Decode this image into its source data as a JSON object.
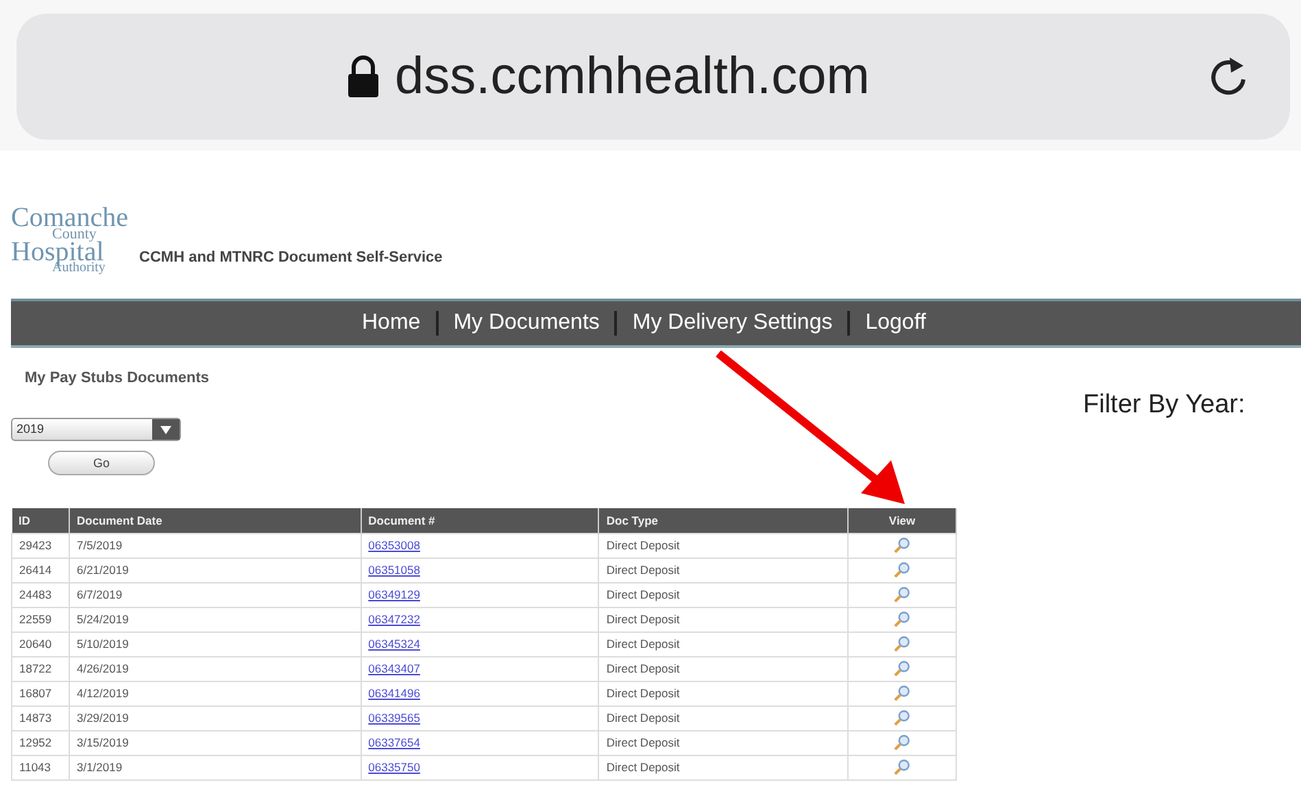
{
  "browser": {
    "url": "dss.ccmhhealth.com"
  },
  "logo": {
    "lines": [
      "Comanche",
      "County",
      "Hospital",
      "Authority"
    ]
  },
  "site_title": "CCMH and MTNRC Document Self-Service",
  "nav": [
    "Home",
    "My Documents",
    "My Delivery Settings",
    "Logoff"
  ],
  "section_title": "My Pay Stubs Documents",
  "filter_label": "Filter By Year:",
  "year_select": {
    "value": "2019"
  },
  "go_button": "Go",
  "table": {
    "columns": [
      "ID",
      "Document Date",
      "Document #",
      "Doc Type",
      "View"
    ],
    "rows": [
      {
        "id": "29423",
        "date": "7/5/2019",
        "doc": "06353008",
        "type": "Direct Deposit"
      },
      {
        "id": "26414",
        "date": "6/21/2019",
        "doc": "06351058",
        "type": "Direct Deposit"
      },
      {
        "id": "24483",
        "date": "6/7/2019",
        "doc": "06349129",
        "type": "Direct Deposit"
      },
      {
        "id": "22559",
        "date": "5/24/2019",
        "doc": "06347232",
        "type": "Direct Deposit"
      },
      {
        "id": "20640",
        "date": "5/10/2019",
        "doc": "06345324",
        "type": "Direct Deposit"
      },
      {
        "id": "18722",
        "date": "4/26/2019",
        "doc": "06343407",
        "type": "Direct Deposit"
      },
      {
        "id": "16807",
        "date": "4/12/2019",
        "doc": "06341496",
        "type": "Direct Deposit"
      },
      {
        "id": "14873",
        "date": "3/29/2019",
        "doc": "06339565",
        "type": "Direct Deposit"
      },
      {
        "id": "12952",
        "date": "3/15/2019",
        "doc": "06337654",
        "type": "Direct Deposit"
      },
      {
        "id": "11043",
        "date": "3/1/2019",
        "doc": "06335750",
        "type": "Direct Deposit"
      }
    ]
  }
}
